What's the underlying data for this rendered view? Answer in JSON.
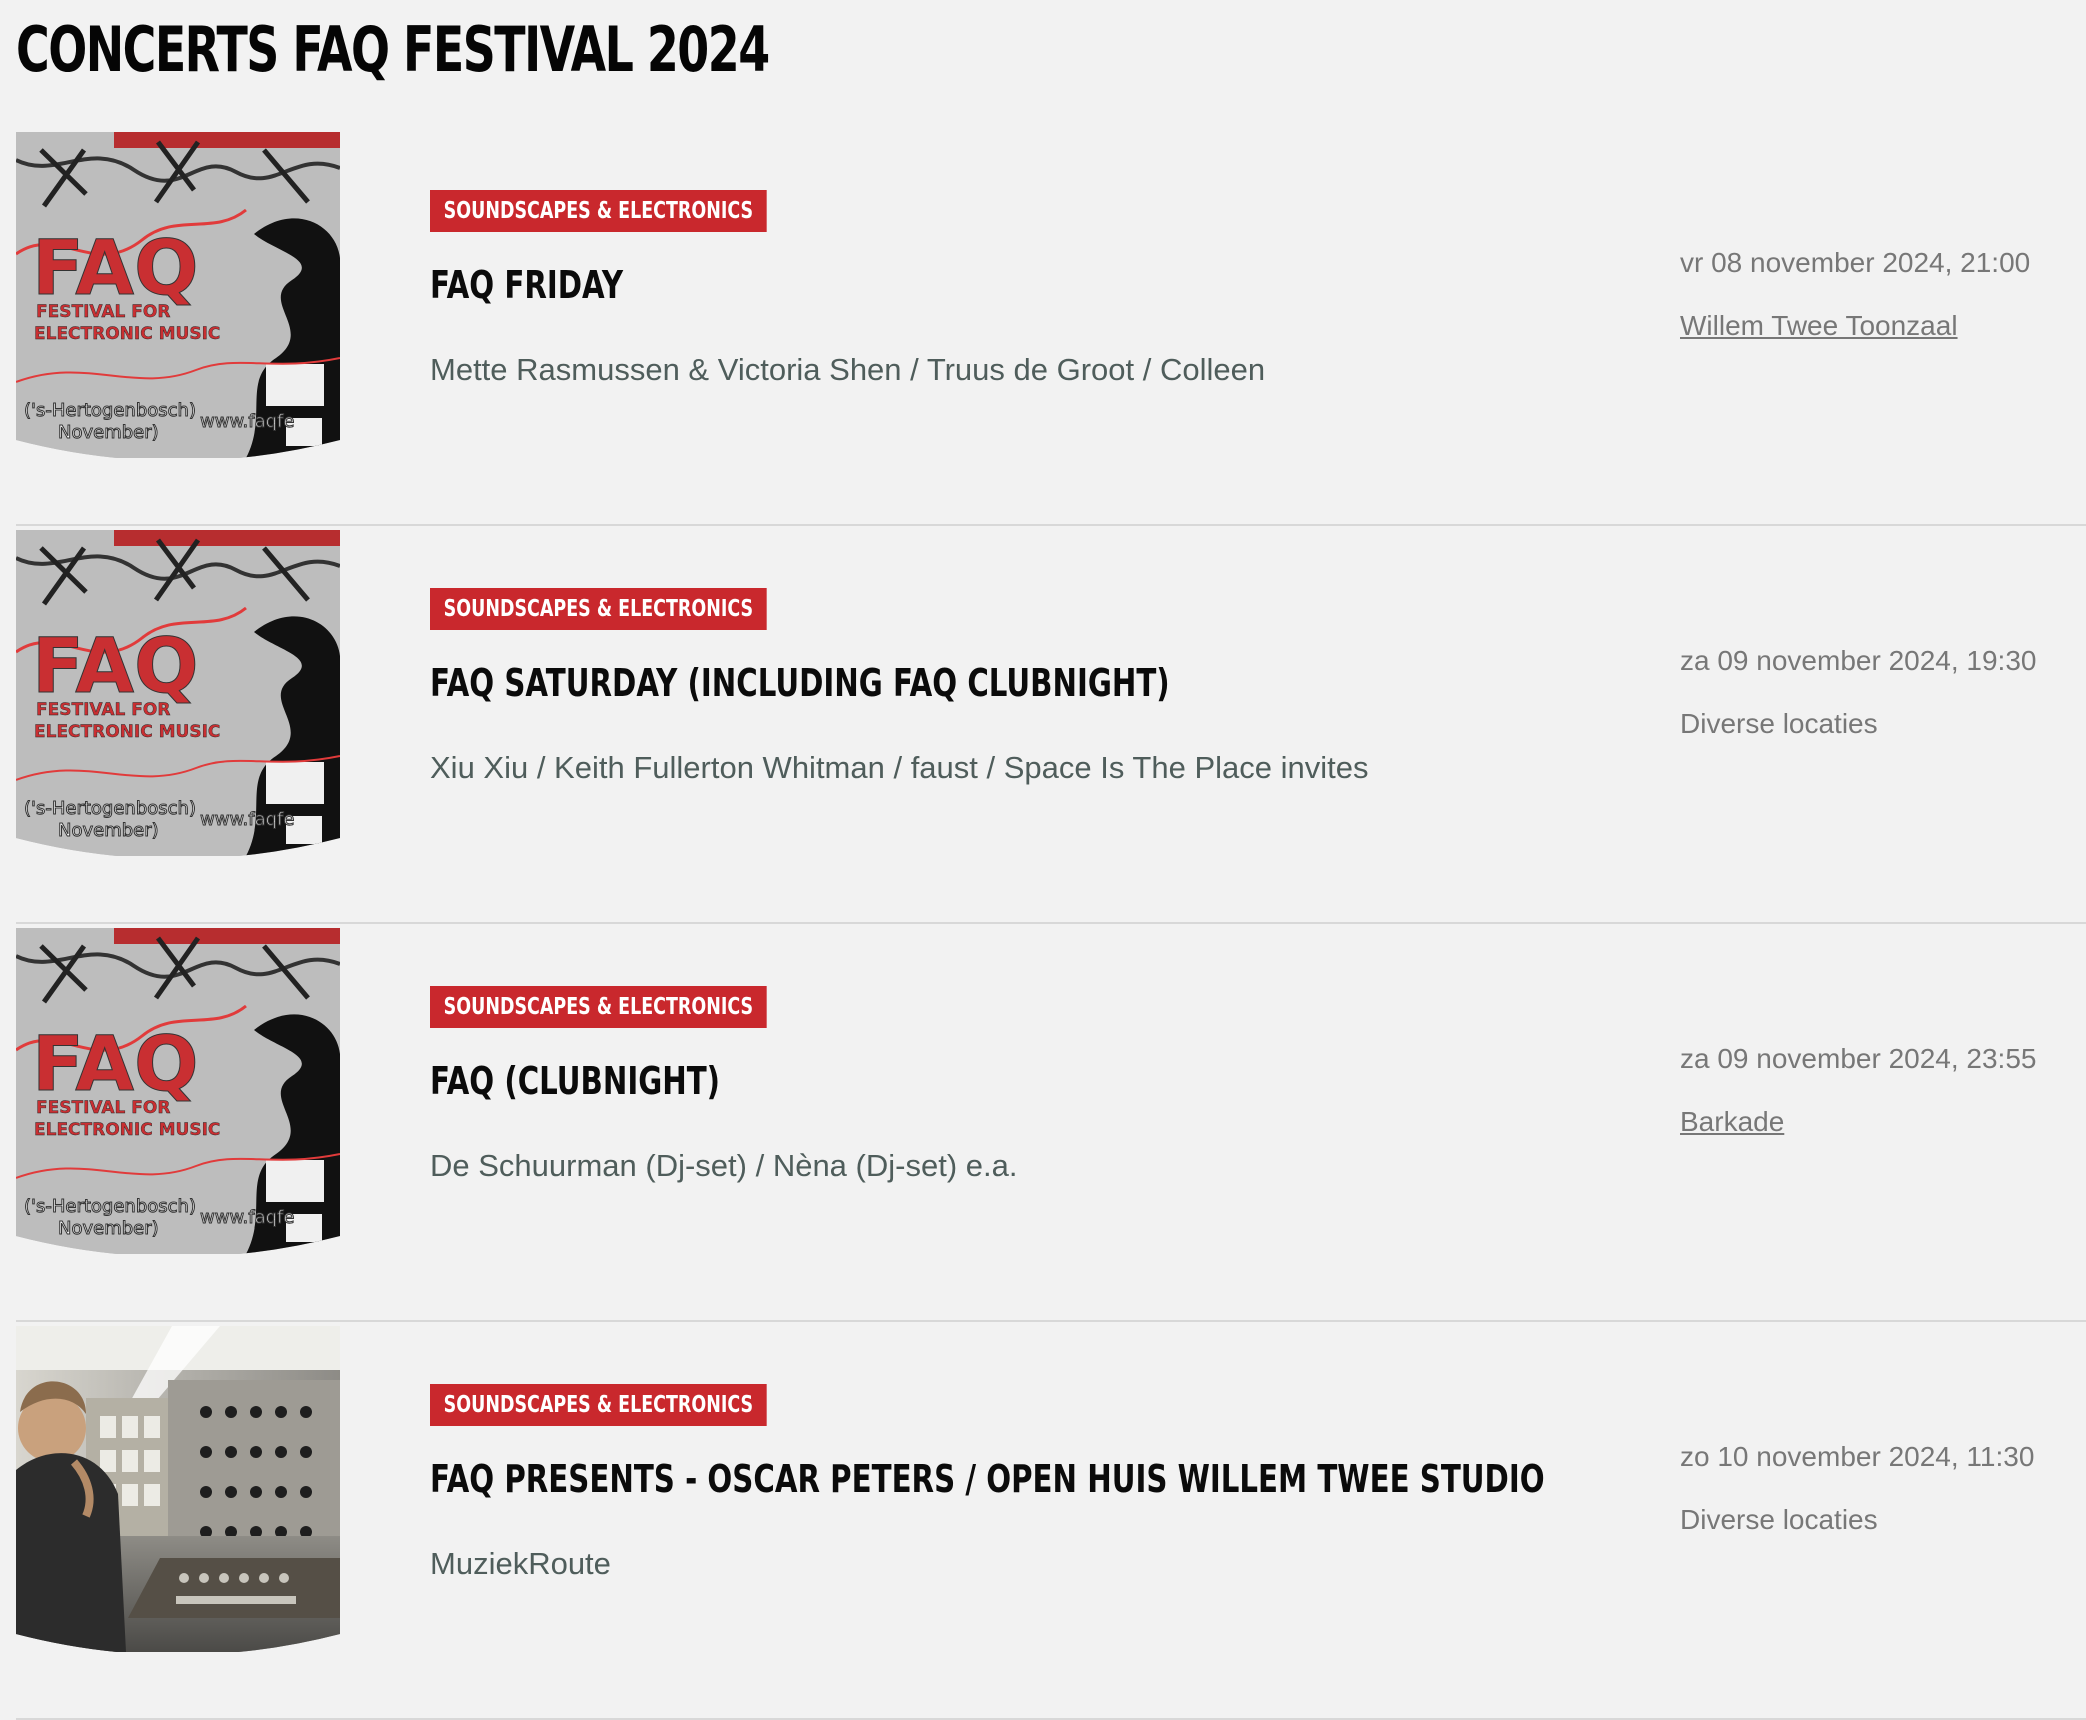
{
  "page": {
    "title": "CONCERTS FAQ FESTIVAL 2024"
  },
  "concerts": [
    {
      "genre": "SOUNDSCAPES & ELECTRONICS",
      "title": "FAQ FRIDAY",
      "artists": "Mette Rasmussen & Victoria Shen / Truus de Groot / Colleen",
      "date": "vr 08 november 2024, 21:00",
      "venue": "Willem Twee Toonzaal",
      "venue_is_link": true,
      "image_type": "faq-poster",
      "image_text": [
        "FAQ",
        "FESTIVAL FOR",
        "ELECTRONIC MUSIC",
        "('s-Hertogenbosch)",
        "November)",
        "www.faqfe"
      ]
    },
    {
      "genre": "SOUNDSCAPES & ELECTRONICS",
      "title": "FAQ SATURDAY (INCLUDING FAQ CLUBNIGHT)",
      "artists": "Xiu Xiu / Keith Fullerton Whitman / faust / Space Is The Place invites",
      "date": "za 09 november 2024, 19:30",
      "venue": "Diverse locaties",
      "venue_is_link": false,
      "image_type": "faq-poster",
      "image_text": [
        "FAQ",
        "FESTIVAL FOR",
        "ELECTRONIC MUSIC",
        "('s-Hertogenbosch)",
        "November)",
        "www.faqfe"
      ]
    },
    {
      "genre": "SOUNDSCAPES & ELECTRONICS",
      "title": "FAQ (CLUBNIGHT)",
      "artists": "De Schuurman (Dj-set) / Nèna (Dj-set) e.a.",
      "date": "za 09 november 2024, 23:55",
      "venue": "Barkade",
      "venue_is_link": true,
      "image_type": "faq-poster",
      "image_text": [
        "FAQ",
        "FESTIVAL FOR",
        "ELECTRONIC MUSIC",
        "('s-Hertogenbosch)",
        "November)",
        "www.faqfe"
      ]
    },
    {
      "genre": "SOUNDSCAPES & ELECTRONICS",
      "title": "FAQ PRESENTS - OSCAR PETERS / OPEN HUIS WILLEM TWEE STUDIO",
      "artists": "MuziekRoute",
      "date": "zo 10 november 2024, 11:30",
      "venue": "Diverse locaties",
      "venue_is_link": false,
      "image_type": "studio-photo",
      "image_text": []
    }
  ],
  "colors": {
    "background": "#f2f2f2",
    "badge": "#c9282d",
    "artist_text": "#4f5d5b",
    "meta_text": "#777777",
    "divider": "#d8d8d8"
  }
}
